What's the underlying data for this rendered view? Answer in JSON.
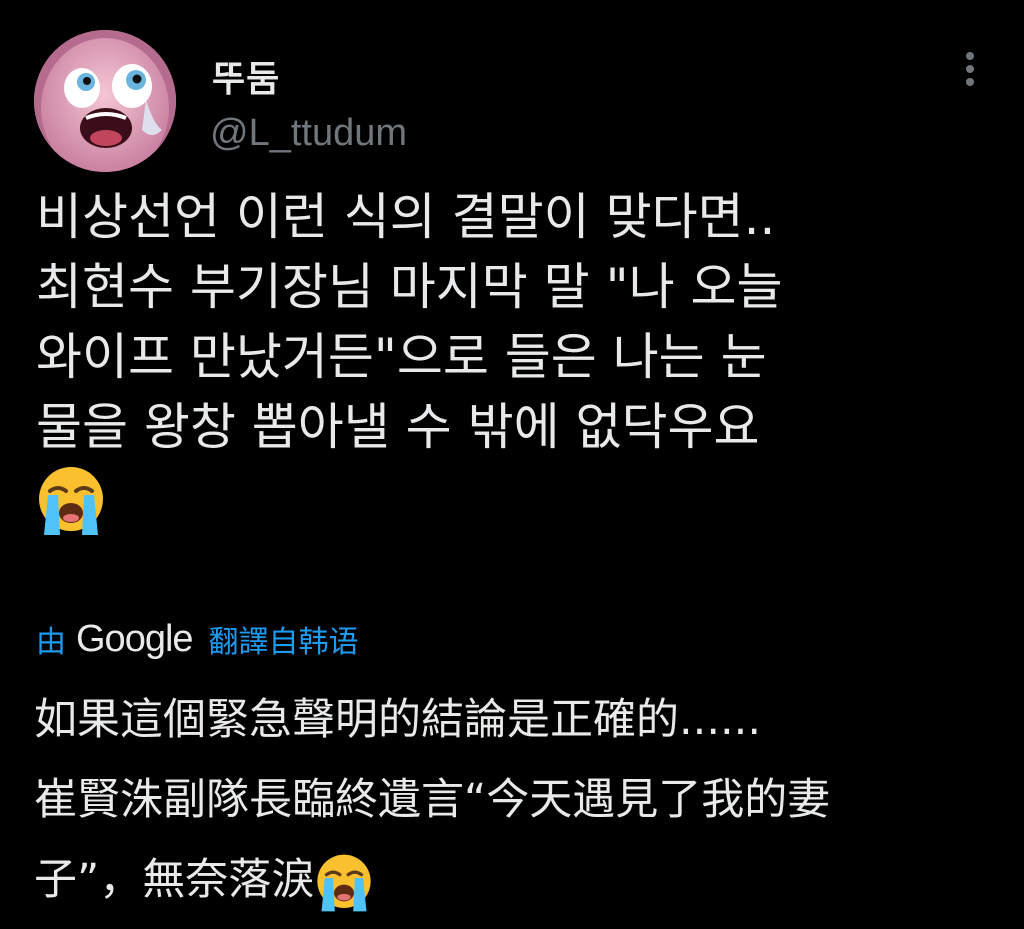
{
  "user": {
    "display_name": "뚜둠",
    "handle": "@L_ttudum",
    "avatar_icon": "avatar-icon"
  },
  "tweet": {
    "lines": [
      "비상선언 이런 식의 결말이 맞다면..",
      "최현수 부기장님 마지막 말 \"나 오늘",
      "와이프 만났거든\"으로 들은 나는 눈",
      "물을 왕창 뽑아낼 수 밖에 없닥우요"
    ],
    "emoji": "loudly-crying-face-icon"
  },
  "translation": {
    "prefix": "由",
    "provider": "Google",
    "suffix": "翻譯自韩语",
    "lines": [
      "如果這個緊急聲明的結論是正確的......",
      "崔賢洙副隊長臨終遺言“今天遇見了我的妻",
      "子”，無奈落淚"
    ],
    "emoji": "loudly-crying-face-icon"
  },
  "colors": {
    "background": "#000000",
    "text": "#e7e9ea",
    "secondary": "#71767b",
    "link": "#1d9bf0"
  }
}
